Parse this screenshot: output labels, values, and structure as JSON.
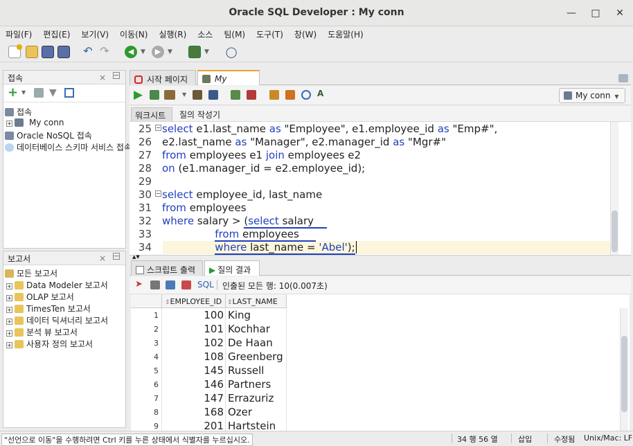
{
  "window": {
    "title": "Oracle SQL Developer : My conn"
  },
  "menu": [
    "파일(F)",
    "편집(E)",
    "보기(V)",
    "이동(N)",
    "실행(R)",
    "소스",
    "팀(M)",
    "도구(T)",
    "창(W)",
    "도움말(H)"
  ],
  "connections_panel": {
    "title": "접속",
    "tree": [
      {
        "label": "접속",
        "icon": "database-connections-icon"
      },
      {
        "label": "My conn",
        "icon": "database-icon",
        "indent": 1
      },
      {
        "label": "Oracle NoSQL 접속",
        "icon": "nosql-icon"
      },
      {
        "label": "데이터베이스 스키마 서비스 접속",
        "icon": "cloud-icon"
      }
    ]
  },
  "reports_panel": {
    "title": "보고서",
    "tree": [
      {
        "label": "모든 보고서"
      },
      {
        "label": "Data Modeler 보고서"
      },
      {
        "label": "OLAP 보고서"
      },
      {
        "label": "TimesTen 보고서"
      },
      {
        "label": "데이터 딕셔너리 보고서"
      },
      {
        "label": "분석 뷰 보고서"
      },
      {
        "label": "사용자 정의 보고서"
      }
    ]
  },
  "editor_tabs": [
    {
      "label": "시작 페이지"
    },
    {
      "label": "My conn",
      "active": true
    }
  ],
  "connection_selector": "My conn",
  "subtabs": [
    "워크시트",
    "질의 작성기"
  ],
  "code_lines": [
    {
      "n": "25",
      "text": "select e1.last_name as \"Employee\", e1.employee_id as \"Emp#\","
    },
    {
      "n": "26",
      "text": "e2.last_name as \"Manager\", e2.manager_id as \"Mgr#\""
    },
    {
      "n": "27",
      "text": "from employees e1 join employees e2"
    },
    {
      "n": "28",
      "text": "on (e1.manager_id = e2.employee_id);"
    },
    {
      "n": "29",
      "text": ""
    },
    {
      "n": "30",
      "text": "select employee_id, last_name"
    },
    {
      "n": "31",
      "text": "from employees"
    },
    {
      "n": "32",
      "text": "where salary > (select salary"
    },
    {
      "n": "33",
      "text": "from employees"
    },
    {
      "n": "34",
      "text": "where last_name = 'Abel');"
    }
  ],
  "result_tabs": [
    {
      "label": "스크립트 출력"
    },
    {
      "label": "질의 결과",
      "active": true
    }
  ],
  "result_toolbar": {
    "sql_label": "SQL",
    "status": "인출된 모든 행: 10(0.007초)"
  },
  "grid": {
    "columns": [
      "EMPLOYEE_ID",
      "LAST_NAME"
    ],
    "rows": [
      {
        "n": "1",
        "id": "100",
        "name": "King"
      },
      {
        "n": "2",
        "id": "101",
        "name": "Kochhar"
      },
      {
        "n": "3",
        "id": "102",
        "name": "De Haan"
      },
      {
        "n": "4",
        "id": "108",
        "name": "Greenberg"
      },
      {
        "n": "5",
        "id": "145",
        "name": "Russell"
      },
      {
        "n": "6",
        "id": "146",
        "name": "Partners"
      },
      {
        "n": "7",
        "id": "147",
        "name": "Errazuriz"
      },
      {
        "n": "8",
        "id": "168",
        "name": "Ozer"
      },
      {
        "n": "9",
        "id": "201",
        "name": "Hartstein"
      }
    ]
  },
  "status_bar": {
    "message": "\"선언으로 이동\"을 수행하려면 Ctrl 키를 누른 상태에서 식별자를 누르십시오.",
    "position": "34 행 56 열",
    "mode": "삽입",
    "modified": "수정됨",
    "eol": "Unix/Mac: LF"
  },
  "colors": {
    "keyword": "#1f3fbf",
    "current_line": "#fbf6dc",
    "accent": "#3a8a3a"
  }
}
